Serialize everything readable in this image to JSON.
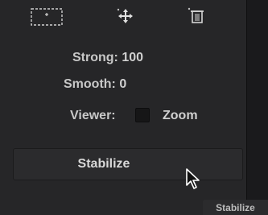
{
  "toolbar": {
    "icons": [
      "crop-track-icon",
      "pan-move-icon",
      "delete-icon"
    ]
  },
  "params": {
    "strong_label": "Strong:",
    "strong_value": "100",
    "smooth_label": "Smooth:",
    "smooth_value": "0",
    "viewer_label": "Viewer:",
    "zoom_label": "Zoom"
  },
  "stabilize_button": {
    "label": "Stabilize"
  },
  "tooltip": {
    "text": "Stabilize"
  },
  "colors": {
    "panel": "#262628",
    "background": "#1b1b1d",
    "text": "#d4d4d4"
  }
}
